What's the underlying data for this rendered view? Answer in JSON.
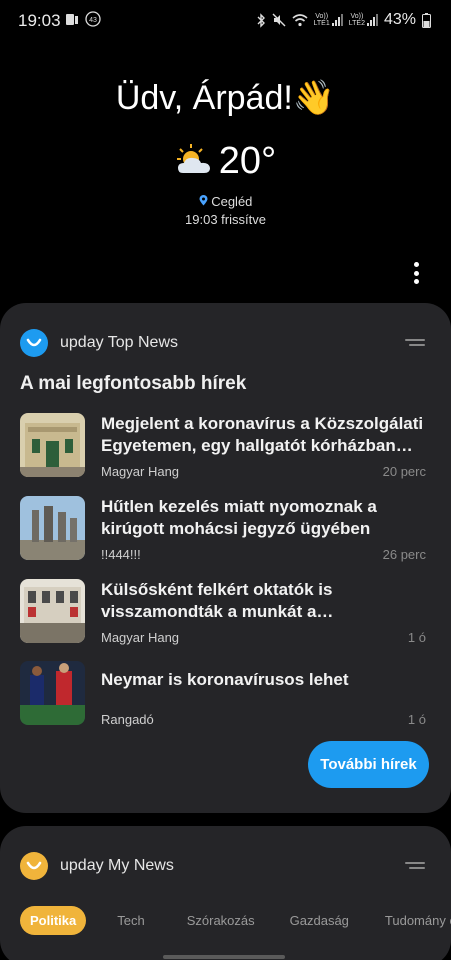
{
  "status_bar": {
    "time": "19:03",
    "notification_badge": "43",
    "lte1": "LTE1",
    "lte2": "LTE2",
    "vol": "Vo))",
    "battery": "43%"
  },
  "greeting": {
    "text": "Üdv, Árpád!",
    "emoji": "👋"
  },
  "weather": {
    "temperature": "20°",
    "icon": "partly-sunny-icon",
    "location": "Cegléd",
    "updated": "19:03 frissítve"
  },
  "top_news": {
    "title": "upday Top News",
    "section_title": "A mai legfontosabb hírek",
    "accent": "#1d9bf0",
    "items": [
      {
        "headline": "Megjelent a koronavírus a Közszolgálati Egyetemen, egy hallgatót kórházban…",
        "source": "Magyar Hang",
        "age": "20 perc"
      },
      {
        "headline": "Hűtlen kezelés miatt nyomoznak a kirúgott mohácsi jegyző ügyében",
        "source": "!!444!!!",
        "age": "26 perc"
      },
      {
        "headline": "Külsősként felkért oktatók is visszamondták a munkát a…",
        "source": "Magyar Hang",
        "age": "1 ó"
      },
      {
        "headline": "Neymar is koronavírusos lehet",
        "source": "Rangadó",
        "age": "1 ó"
      }
    ],
    "more_button": "További hírek"
  },
  "my_news": {
    "title": "upday My News",
    "accent": "#f0b43b",
    "tabs": [
      "Politika",
      "Tech",
      "Szórakozás",
      "Gazdaság",
      "Tudomány é"
    ]
  }
}
